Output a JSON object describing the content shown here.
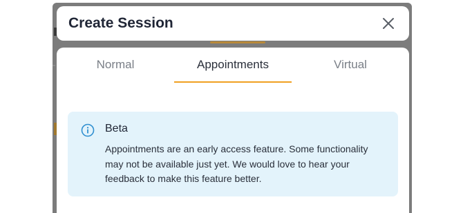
{
  "modal": {
    "title": "Create Session",
    "close_label": "Close"
  },
  "tabs": [
    {
      "label": "Normal",
      "active": false
    },
    {
      "label": "Appointments",
      "active": true
    },
    {
      "label": "Virtual",
      "active": false
    }
  ],
  "callout": {
    "title": "Beta",
    "text": "Appointments are an early access feature. Some functionality may not be available just yet. We would love to hear your feedback to make this feature better.",
    "icon": "info-icon"
  },
  "colors": {
    "accent": "#f0a020",
    "callout_bg": "#e3f3fb",
    "info_icon": "#2f8fd0",
    "title_text": "#1f2535"
  }
}
